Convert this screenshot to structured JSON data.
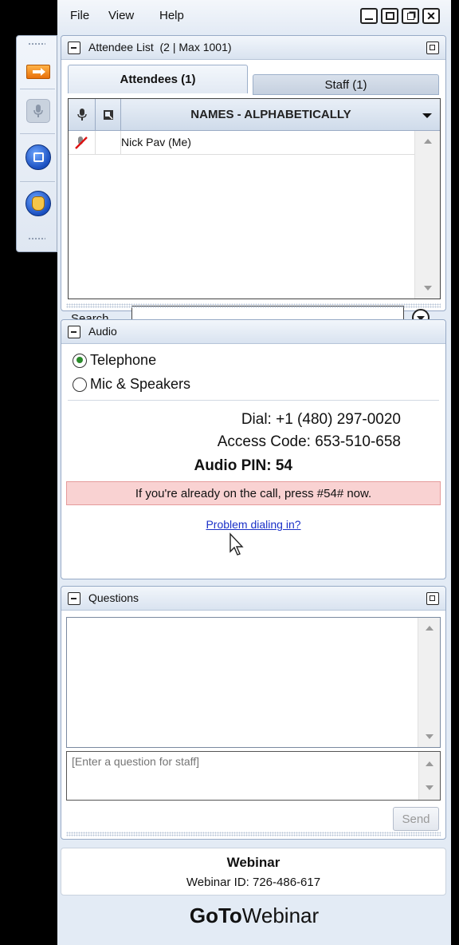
{
  "menu": {
    "file": "File",
    "view": "View",
    "help": "Help"
  },
  "attendee_panel": {
    "title": "Attendee List",
    "count": "(2 | Max 1001)",
    "tabs": [
      {
        "label": "Attendees (1)",
        "active": true
      },
      {
        "label": "Staff (1)",
        "active": false
      }
    ],
    "column_header": "NAMES - ALPHABETICALLY",
    "rows": [
      {
        "name": "Nick Pav (Me)"
      }
    ],
    "search_label": "Search",
    "search_value": ""
  },
  "audio_panel": {
    "title": "Audio",
    "options": [
      {
        "label": "Telephone",
        "selected": true
      },
      {
        "label": "Mic & Speakers",
        "selected": false
      }
    ],
    "dial": "Dial: +1 (480) 297-0020",
    "access_code": "Access Code: 653-510-658",
    "audio_pin": "Audio PIN: 54",
    "notice": "If you're already on the call, press #54# now.",
    "help_link": "Problem dialing in?"
  },
  "questions_panel": {
    "title": "Questions",
    "input_placeholder": "[Enter a question for staff]",
    "send_label": "Send"
  },
  "footer": {
    "title": "Webinar",
    "webinar_id": "Webinar ID: 726-486-617",
    "brand_bold": "GoTo",
    "brand_regular": "Webinar"
  },
  "colors": {
    "accent_blue": "#1a4fc0",
    "notice_bg": "#f9d2d2",
    "link": "#1b31c8"
  }
}
